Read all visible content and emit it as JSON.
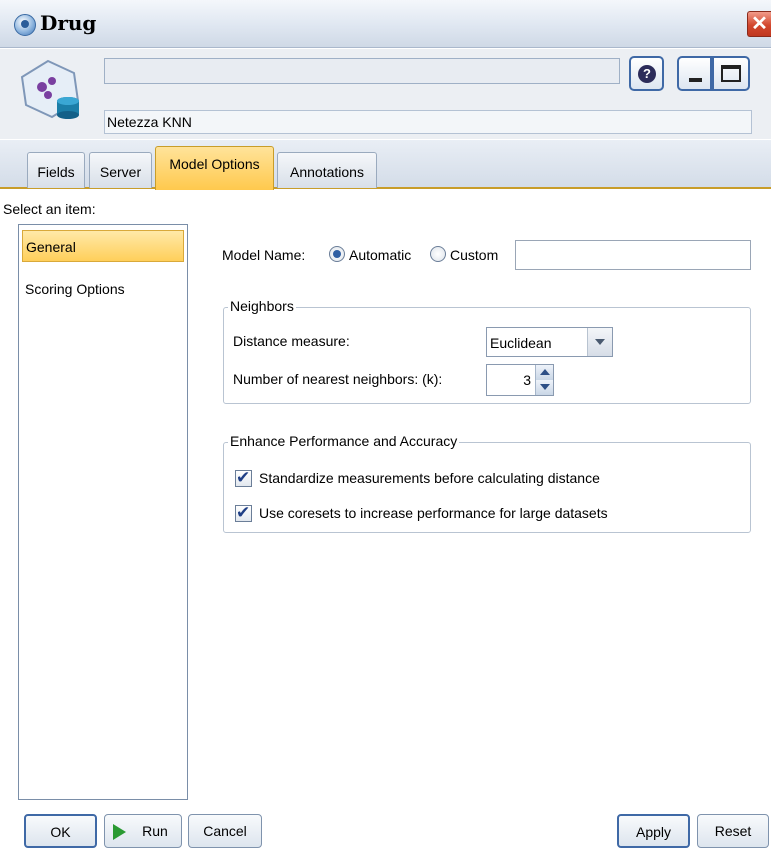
{
  "window": {
    "title": "Drug",
    "close_glyph": "✕"
  },
  "header": {
    "name_value": "",
    "node_label": "Netezza KNN",
    "help_glyph": "?"
  },
  "tabs": [
    {
      "label": "Fields",
      "active": false
    },
    {
      "label": "Server",
      "active": false
    },
    {
      "label": "Model Options",
      "active": true
    },
    {
      "label": "Annotations",
      "active": false
    }
  ],
  "sidebar": {
    "prompt": "Select an item:",
    "items": [
      {
        "label": "General",
        "selected": true
      },
      {
        "label": "Scoring Options",
        "selected": false
      }
    ]
  },
  "model_name": {
    "label": "Model Name:",
    "options": [
      {
        "label": "Automatic",
        "selected": true
      },
      {
        "label": "Custom",
        "selected": false
      }
    ],
    "custom_value": ""
  },
  "neighbors": {
    "title": "Neighbors",
    "distance_label": "Distance measure:",
    "distance_value": "Euclidean",
    "k_label": "Number of nearest neighbors: (k):",
    "k_value": "3"
  },
  "enhance": {
    "title": "Enhance Performance and Accuracy",
    "standardize_label": "Standardize measurements before calculating distance",
    "standardize_checked": true,
    "coresets_label": "Use coresets to increase performance for large datasets",
    "coresets_checked": true
  },
  "footer": {
    "ok": "OK",
    "run": "Run",
    "cancel": "Cancel",
    "apply": "Apply",
    "reset": "Reset"
  },
  "colors": {
    "accent": "#3f69a6",
    "tab_active": "#ffc94d",
    "run_green": "#2a9a32",
    "close_red": "#d2472e"
  },
  "icons": [
    "app-icon",
    "database-model-icon",
    "help-icon",
    "minimize-icon",
    "maximize-icon",
    "close-icon",
    "run-icon",
    "dropdown-arrow-icon",
    "spin-up-icon",
    "spin-down-icon",
    "checkmark-icon"
  ]
}
